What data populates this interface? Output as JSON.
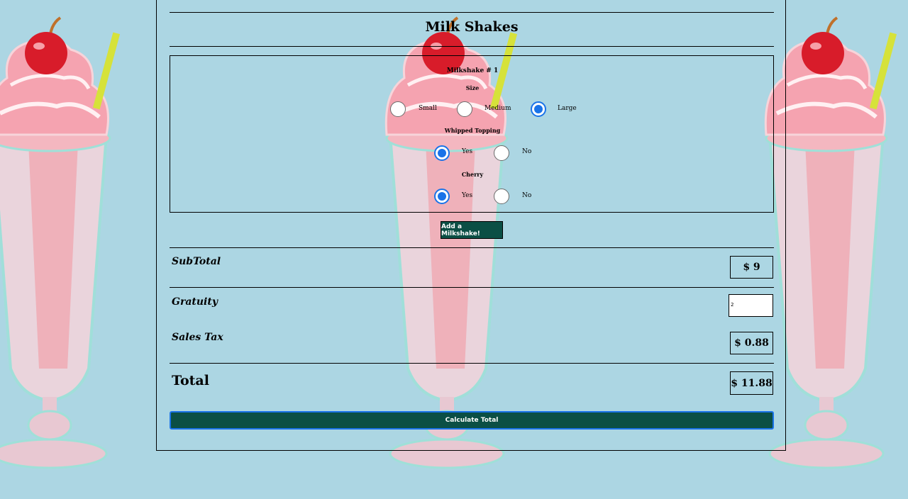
{
  "page": {
    "title": "Milk Shakes"
  },
  "milkshake": {
    "heading": "Milkshake # 1",
    "size": {
      "label": "Size",
      "options": [
        "Small",
        "Medium",
        "Large"
      ],
      "selected": "Large"
    },
    "whipped": {
      "label": "Whipped Topping",
      "options": [
        "Yes",
        "No"
      ],
      "selected": "Yes"
    },
    "cherry": {
      "label": "Cherry",
      "options": [
        "Yes",
        "No"
      ],
      "selected": "Yes"
    }
  },
  "add_button": "Add a Milkshake!",
  "summary": {
    "subtotal_label": "SubTotal",
    "subtotal_value": "$ 9",
    "gratuity_label": "Gratuity",
    "gratuity_value": "2",
    "tax_label": "Sales Tax",
    "tax_value": "$ 0.88",
    "total_label": "Total",
    "total_value": "$ 11.88"
  },
  "calculate_button": "Calculate Total",
  "colors": {
    "background": "#acd6e3",
    "button": "#0b4f45",
    "radio_accent": "#1a73e8"
  }
}
